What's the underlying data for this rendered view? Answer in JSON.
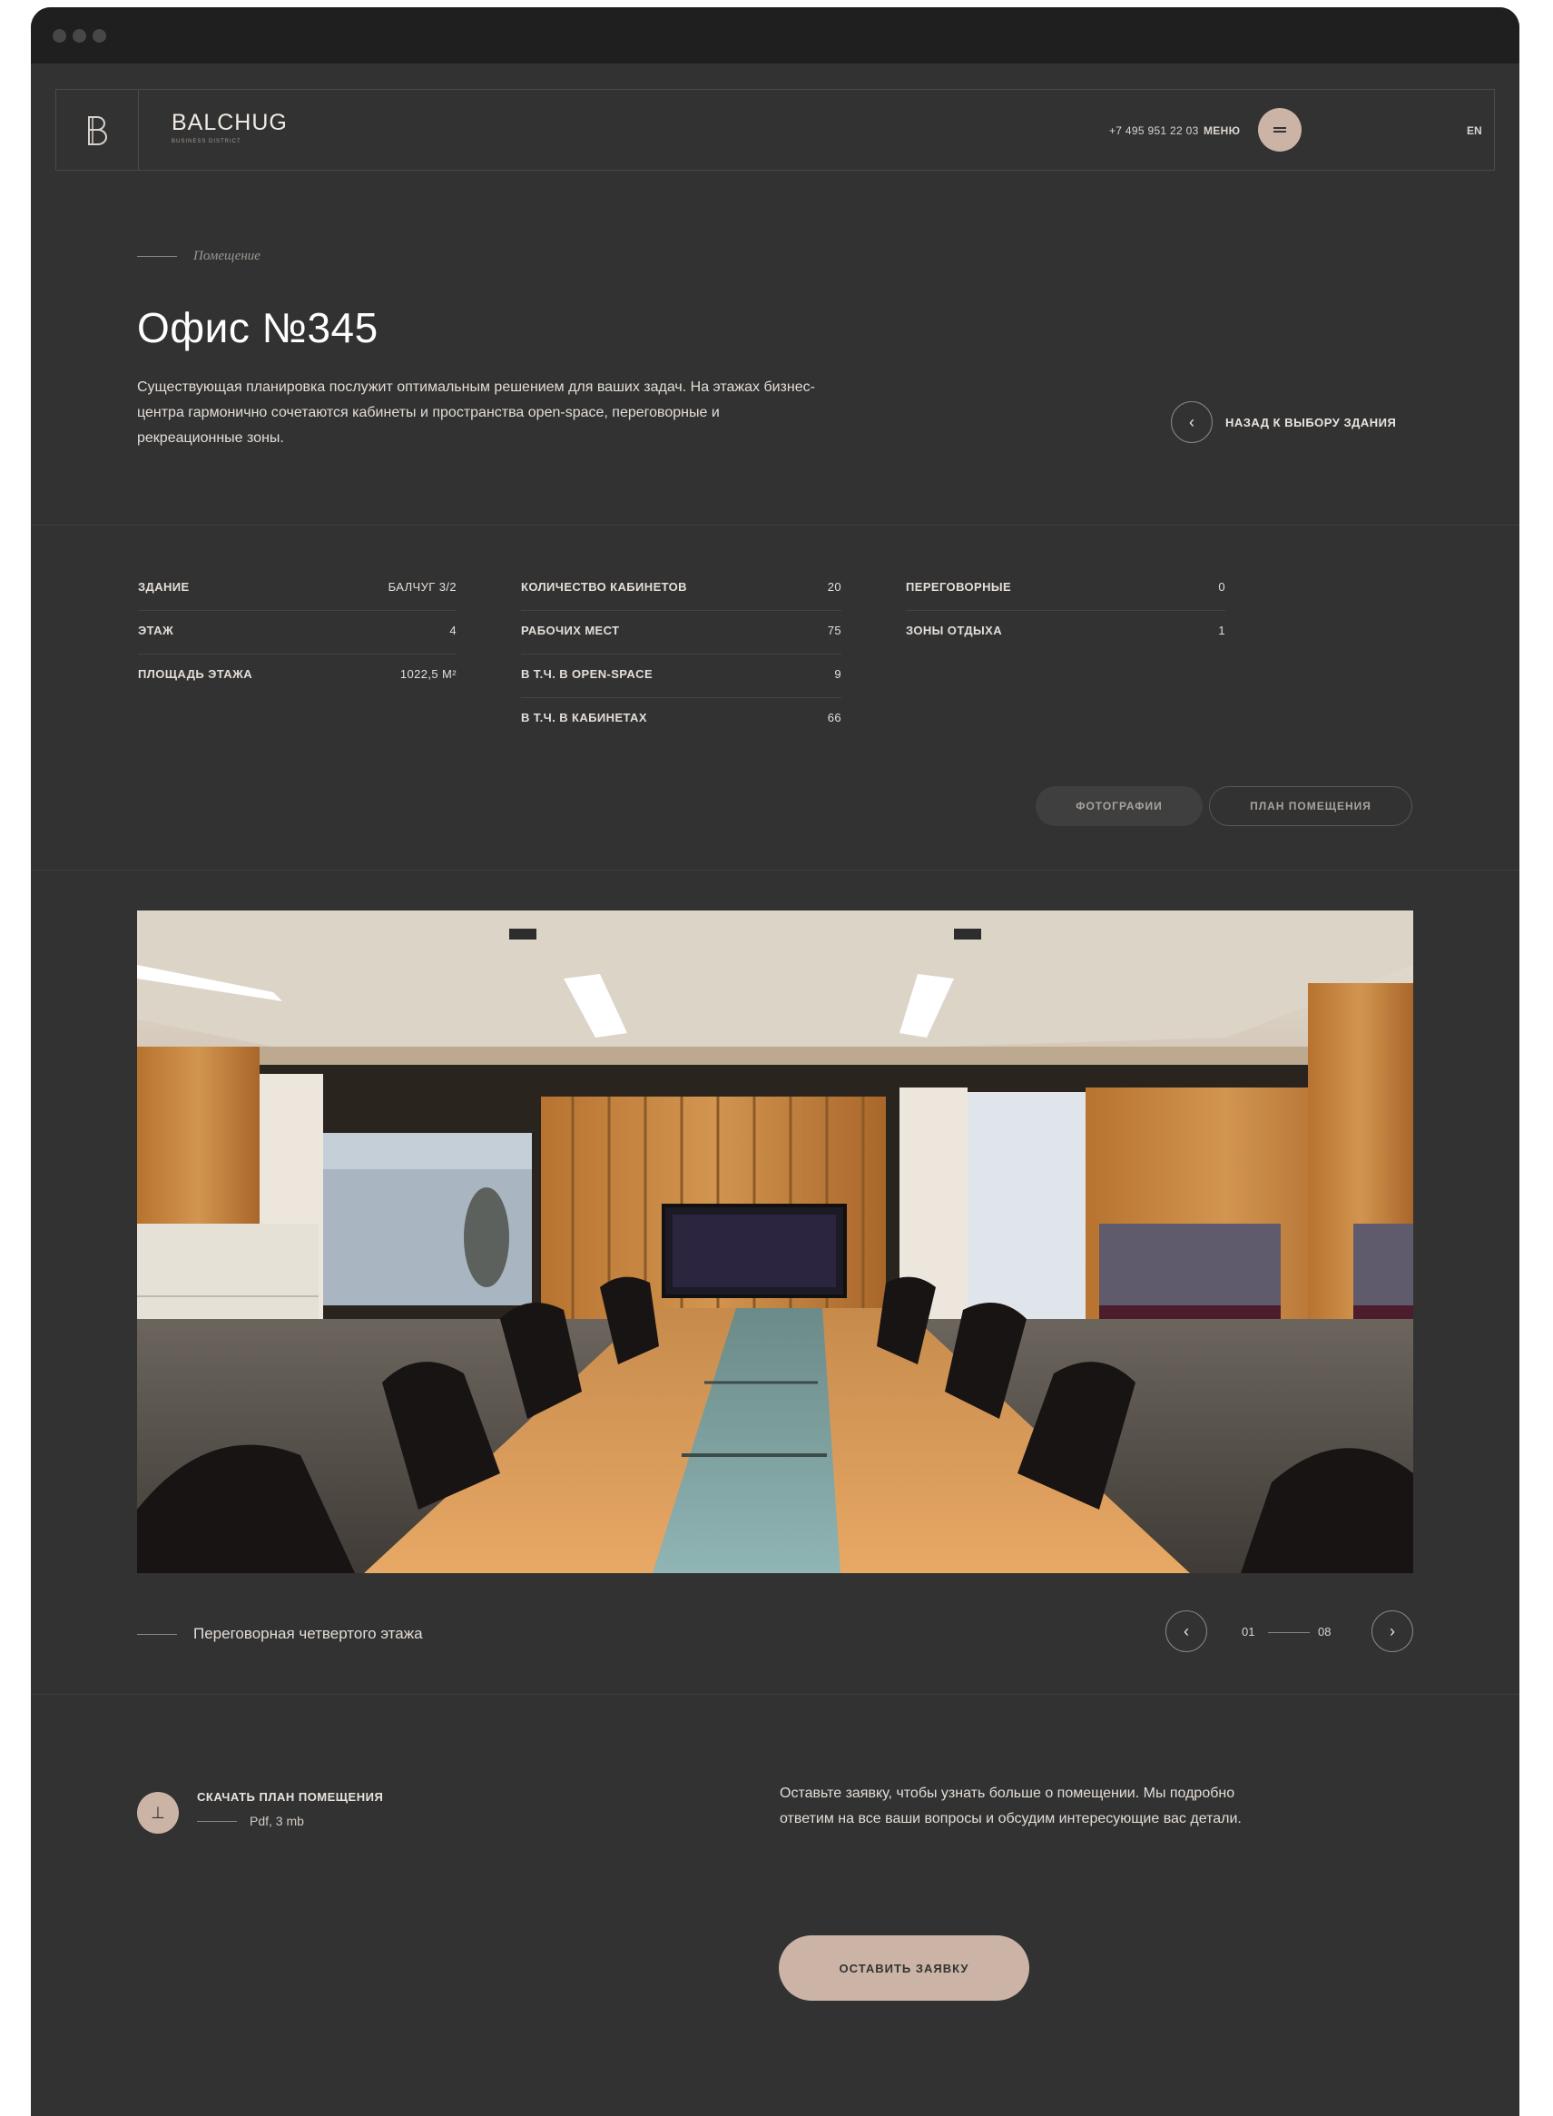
{
  "header": {
    "brand_name": "BALCHUG",
    "brand_sub": "BUSINESS DISTRICT",
    "phone": "+7 495 951 22 03",
    "menu_label": "МЕНЮ",
    "lang": "EN"
  },
  "intro": {
    "section_label": "Помещение",
    "title": "Офис №345",
    "description": "Существующая планировка послужит оптимальным решением для ваших задач. На этажах бизнес-центра гармонично сочетаются кабинеты и пространства open-space, переговорные и рекреационные зоны.",
    "back_label": "НАЗАД К ВЫБОРУ ЗДАНИЯ"
  },
  "stats": {
    "col1": [
      {
        "key": "ЗДАНИЕ",
        "value": "БАЛЧУГ 3/2"
      },
      {
        "key": "ЭТАЖ",
        "value": "4"
      },
      {
        "key": "ПЛОЩАДЬ ЭТАЖА",
        "value": "1022,5 М²"
      }
    ],
    "col2": [
      {
        "key": "КОЛИЧЕСТВО КАБИНЕТОВ",
        "value": "20"
      },
      {
        "key": "РАБОЧИХ МЕСТ",
        "value": "75"
      },
      {
        "key": "В Т.Ч. В OPEN-SPACE",
        "value": "9"
      },
      {
        "key": "В Т.Ч. В КАБИНЕТАХ",
        "value": "66"
      }
    ],
    "col3": [
      {
        "key": "ПЕРЕГОВОРНЫЕ",
        "value": "0"
      },
      {
        "key": "ЗОНЫ ОТДЫХА",
        "value": "1"
      }
    ]
  },
  "tabs": {
    "photos": "ФОТОГРАФИИ",
    "plan": "ПЛАН ПОМЕЩЕНИЯ"
  },
  "gallery": {
    "caption": "Переговорная четвертого этажа",
    "current": "01",
    "total": "08"
  },
  "download": {
    "title": "СКАЧАТЬ ПЛАН ПОМЕЩЕНИЯ",
    "meta": "Pdf, 3 mb"
  },
  "cta": {
    "text": "Оставьте заявку, чтобы узнать больше о помещении. Мы подробно ответим на все ваши вопросы и обсудим интересующие вас детали.",
    "button": "ОСТАВИТЬ ЗАЯВКУ"
  },
  "colors": {
    "page_bg": "#333232",
    "accent": "#cbb4a5",
    "titlebar": "#1f1f1f"
  }
}
